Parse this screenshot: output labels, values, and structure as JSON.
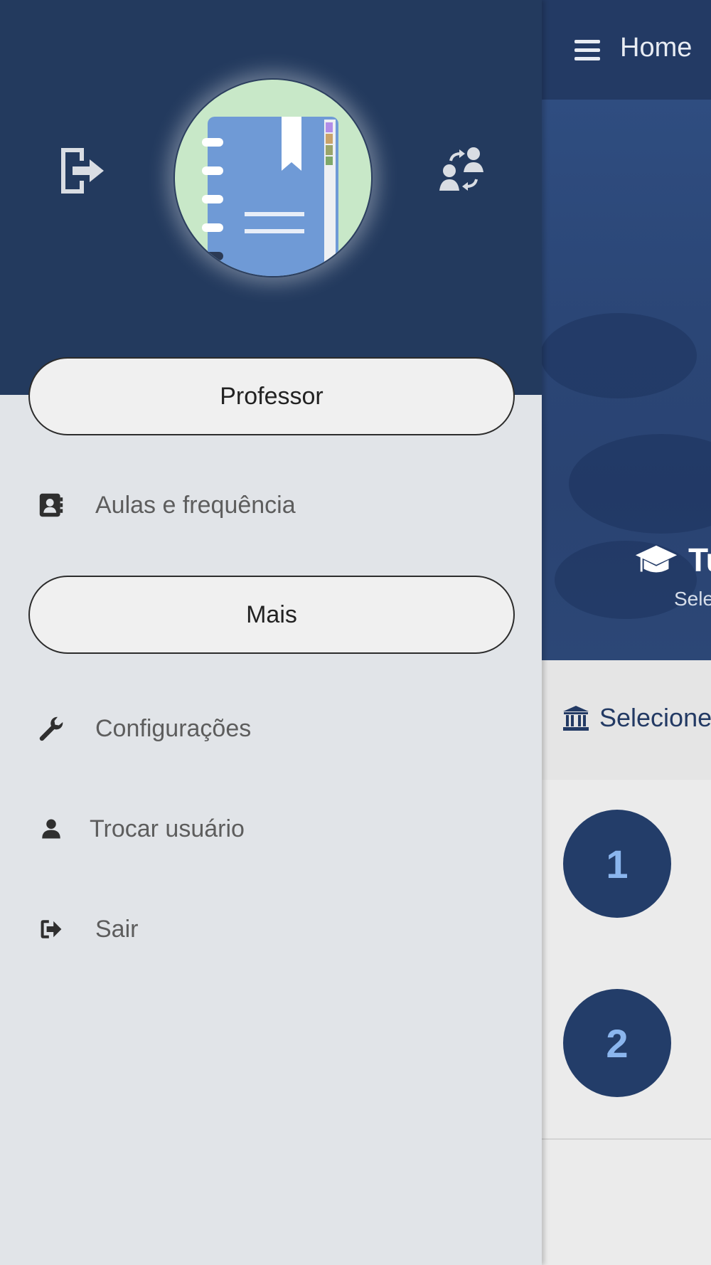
{
  "app": {
    "title": "Home",
    "hero_title": "Tu",
    "hero_subtitle": "Sele",
    "select_text": "Selecione",
    "list_numbers": [
      "1",
      "2"
    ]
  },
  "drawer": {
    "section_professor": "Professor",
    "item_aulas": "Aulas e frequência",
    "section_mais": "Mais",
    "item_config": "Configurações",
    "item_trocar": "Trocar usuário",
    "item_sair": "Sair"
  },
  "icons": {
    "header_left": "exit-door-icon",
    "header_right": "switch-users-icon",
    "avatar": "notebook-logo",
    "aulas": "contact-book-icon",
    "config": "wrench-icon",
    "trocar": "user-icon",
    "sair": "sign-out-icon",
    "menu": "hamburger-icon",
    "hero": "graduation-cap-icon",
    "select": "bank-icon"
  },
  "colors": {
    "primary": "#233a64",
    "drawer_bg": "#e1e4e8",
    "number_text": "#8bb6ee"
  }
}
